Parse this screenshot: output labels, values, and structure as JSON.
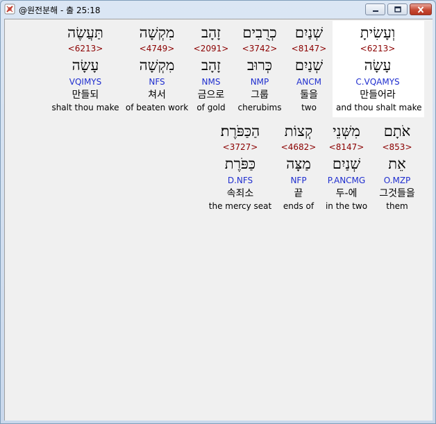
{
  "window": {
    "title": "@원전분해 - 출 25:18",
    "icons": {
      "app": "app-icon",
      "minimize": "minimize-icon",
      "maximize": "maximize-icon",
      "close": "close-icon"
    }
  },
  "verse": {
    "row1": [
      {
        "hebrew": "וְעָשִׂיתָ",
        "strong": "<6213>",
        "lemma": "עָשָׂה",
        "morph": "C.VQAMYS",
        "korean": "만들어라",
        "english": "and thou shalt make"
      },
      {
        "hebrew": "שְׁנַיִם",
        "strong": "<8147>",
        "lemma": "שְׁנַיִם",
        "morph": "ANCM",
        "korean": "둘을",
        "english": "two"
      },
      {
        "hebrew": "כְרֻבִים",
        "strong": "<3742>",
        "lemma": "כְּרוּב",
        "morph": "NMP",
        "korean": "그룹",
        "english": "cherubims"
      },
      {
        "hebrew": "זָהָב",
        "strong": "<2091>",
        "lemma": "זָהָב",
        "morph": "NMS",
        "korean": "금으로",
        "english": "of gold"
      },
      {
        "hebrew": "מִקְשָׁה",
        "strong": "<4749>",
        "lemma": "מִקְשָׁה",
        "morph": "NFS",
        "korean": "쳐서",
        "english": "of beaten work"
      },
      {
        "hebrew": "תַּעֲשֶׂה",
        "strong": "<6213>",
        "lemma": "עָשָׂה",
        "morph": "VQIMYS",
        "korean": "만들되",
        "english": "shalt thou make"
      }
    ],
    "row2": [
      {
        "hebrew": "אֹתָם",
        "strong": "<853>",
        "lemma": "אֵת",
        "morph": "O.MZP",
        "korean": "그것들을",
        "english": "them"
      },
      {
        "hebrew": "מִשְּׁנֵי",
        "strong": "<8147>",
        "lemma": "שְׁנַיִם",
        "morph": "P.ANCMG",
        "korean": "두-에",
        "english": "in the two"
      },
      {
        "hebrew": "קְצוֹת",
        "strong": "<4682>",
        "lemma": "מַצָּה",
        "morph": "NFP",
        "korean": "끝",
        "english": "ends of"
      },
      {
        "hebrew": "הַכַּפֹּרֶת׃",
        "strong": "<3727>",
        "lemma": "כַּפֹּרֶת",
        "morph": "D.NFS",
        "korean": "속죄소",
        "english": "the mercy seat"
      }
    ]
  },
  "colors": {
    "strong": "#8b0000",
    "morph": "#1f2ecf",
    "highlight": "#ffffff",
    "client_bg": "#f0f0f0"
  }
}
